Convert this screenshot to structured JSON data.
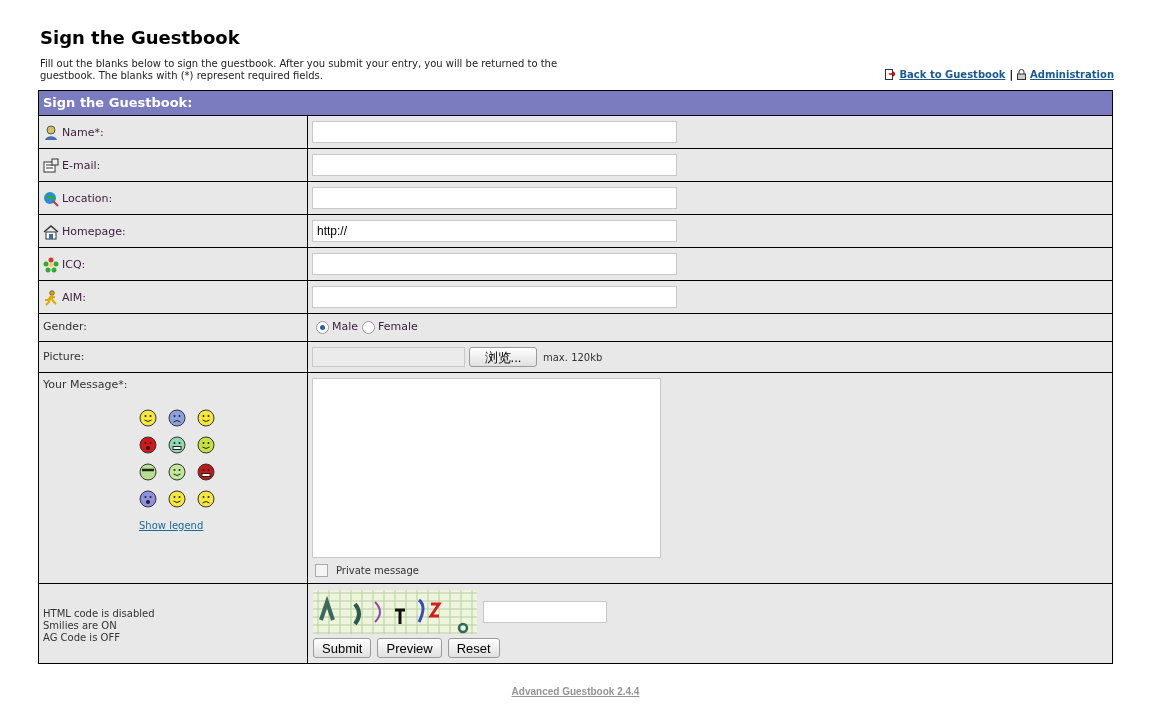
{
  "title": "Sign the Guestbook",
  "intro": "Fill out the blanks below to sign the guestbook. After you submit your entry, you will be returned to the guestbook. The blanks with (*) represent required fields.",
  "links": [
    {
      "label": "Back to Guestbook"
    },
    {
      "label": "Administration"
    }
  ],
  "link_separator": "|",
  "form": {
    "header": "Sign the Guestbook:",
    "fields": [
      {
        "label": "Name*:"
      },
      {
        "label": "E-mail:"
      },
      {
        "label": "Location:"
      },
      {
        "label": "Homepage:",
        "value": "http://"
      },
      {
        "label": "ICQ:"
      },
      {
        "label": "AIM:"
      }
    ],
    "gender": {
      "label": "Gender:",
      "options": [
        {
          "label": "Male",
          "selected": true
        },
        {
          "label": "Female",
          "selected": false
        }
      ]
    },
    "picture": {
      "label": "Picture:",
      "button": "浏览...",
      "note": "max. 120kb"
    },
    "message": {
      "label": "Your Message*:",
      "legend_link": "Show legend",
      "private": {
        "label": "Private message",
        "checked": false
      }
    },
    "info": [
      "HTML code is disabled",
      "Smilies are ON",
      "AG Code is OFF"
    ],
    "buttons": [
      "Submit",
      "Preview",
      "Reset"
    ]
  },
  "footer": "Advanced Guestbook 2.4.4"
}
